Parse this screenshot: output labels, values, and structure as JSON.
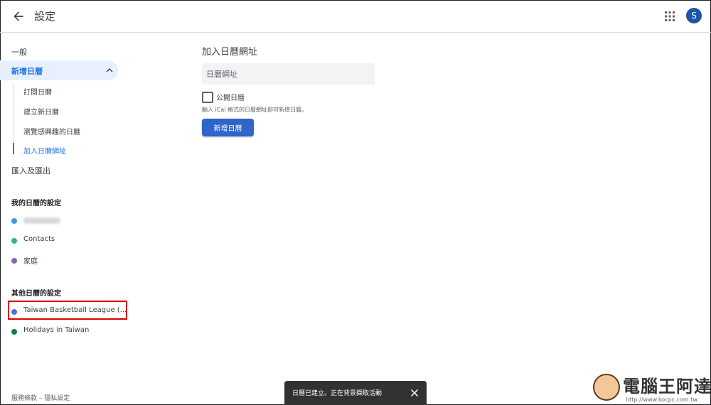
{
  "header": {
    "title": "設定",
    "avatar_letter": "S"
  },
  "sidebar": {
    "general": "一般",
    "add_calendar": "新增日曆",
    "sub_items": [
      "訂閱日曆",
      "建立新日曆",
      "瀏覽感興趣的日曆",
      "加入日曆網址"
    ],
    "import_export": "匯入及匯出",
    "my_calendars_title": "我的日曆的設定",
    "my_calendars": [
      {
        "label": "",
        "color": "#3d9be9",
        "blurred": true
      },
      {
        "label": "Contacts",
        "color": "#33b679"
      },
      {
        "label": "家庭",
        "color": "#8e5fc2"
      }
    ],
    "other_calendars_title": "其他日曆的設定",
    "other_calendars": [
      {
        "label": "Taiwan Basketball League (...",
        "color": "#4a73d9"
      },
      {
        "label": "Holidays in Taiwan",
        "color": "#0b8043"
      }
    ],
    "footer": "服務條款 – 隱私設定"
  },
  "main": {
    "title": "加入日曆網址",
    "url_placeholder": "日曆網址",
    "public_label": "公開日曆",
    "hint": "輸入 iCal 格式的日曆網址即可新增日曆。",
    "add_button": "新增日曆"
  },
  "snackbar": {
    "text": "日曆已建立。正在背景擷取活動"
  },
  "watermark": {
    "text": "電腦王阿達",
    "url": "http://www.kocpc.com.tw"
  },
  "colors": {
    "accent": "#1a73e8",
    "button": "#2f65c9",
    "highlight_box": "#e00000"
  }
}
